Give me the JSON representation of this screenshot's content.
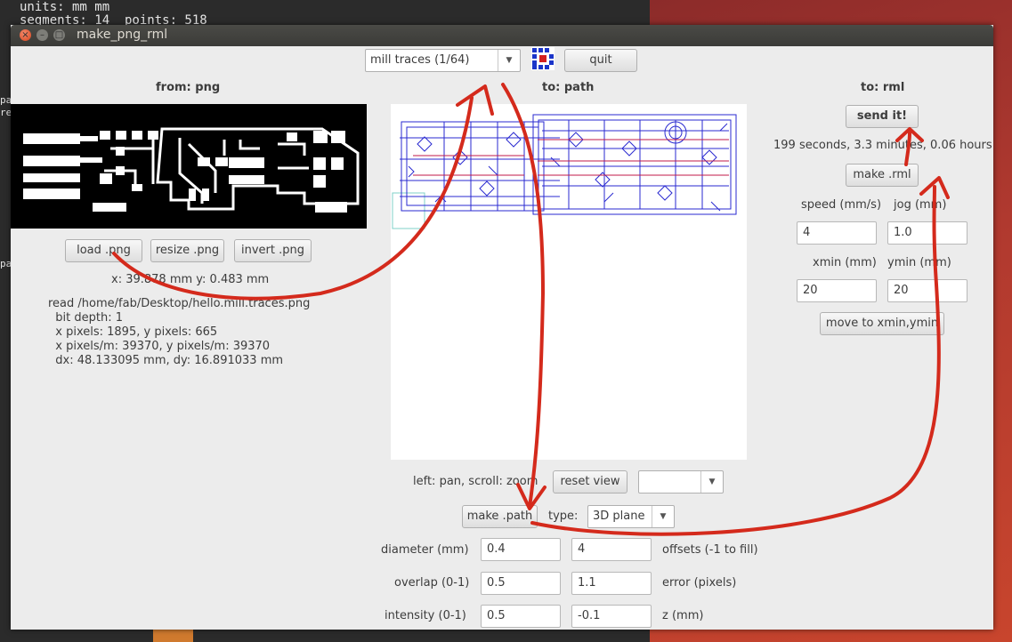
{
  "terminal": {
    "line1": "units: mm mm",
    "line2": "segments: 14  points: 518",
    "edge1": "pa",
    "edge2": "re",
    "edge3": "pa"
  },
  "window": {
    "title": "make_png_rml"
  },
  "toolbar": {
    "process_value": "mill traces (1/64)",
    "quit_label": "quit",
    "logo_icon": "fab-logo-icon"
  },
  "png_panel": {
    "header": "from: png",
    "load_label": "load .png",
    "resize_label": "resize .png",
    "invert_label": "invert .png",
    "coords": "x: 39.878 mm  y: 0.483 mm",
    "info": "read /home/fab/Desktop/hello.mill.traces.png\n  bit depth: 1\n  x pixels: 1895, y pixels: 665\n  x pixels/m: 39370, y pixels/m: 39370\n  dx: 48.133095 mm, dy: 16.891033 mm"
  },
  "path_panel": {
    "header": "to: path",
    "view_hint": "left: pan, scroll: zoom",
    "reset_view_label": "reset view",
    "view_select_value": "",
    "make_path_label": "make .path",
    "type_label": "type:",
    "type_value": "3D plane",
    "diameter_label": "diameter (mm)",
    "diameter_value": "0.4",
    "offsets_value": "4",
    "offsets_label": "offsets (-1 to fill)",
    "overlap_label": "overlap (0-1)",
    "overlap_value": "0.5",
    "error_value": "1.1",
    "error_label": "error (pixels)",
    "intensity_label": "intensity (0-1)",
    "intensity_value": "0.5",
    "z_value": "-0.1",
    "z_label": "z (mm)"
  },
  "rml_panel": {
    "header": "to: rml",
    "send_label": "send it!",
    "time_estimate": "199 seconds, 3.3 minutes, 0.06 hours",
    "make_rml_label": "make .rml",
    "speed_label": "speed (mm/s)",
    "jog_label": "jog (mm)",
    "speed_value": "4",
    "jog_value": "1.0",
    "xmin_label": "xmin (mm)",
    "ymin_label": "ymin (mm)",
    "xmin_value": "20",
    "ymin_value": "20",
    "move_label": "move to xmin,ymin"
  },
  "colors": {
    "annotation_red": "#d42a1c",
    "path_blue": "#2a2ad0",
    "path_red": "#c01a4a"
  }
}
